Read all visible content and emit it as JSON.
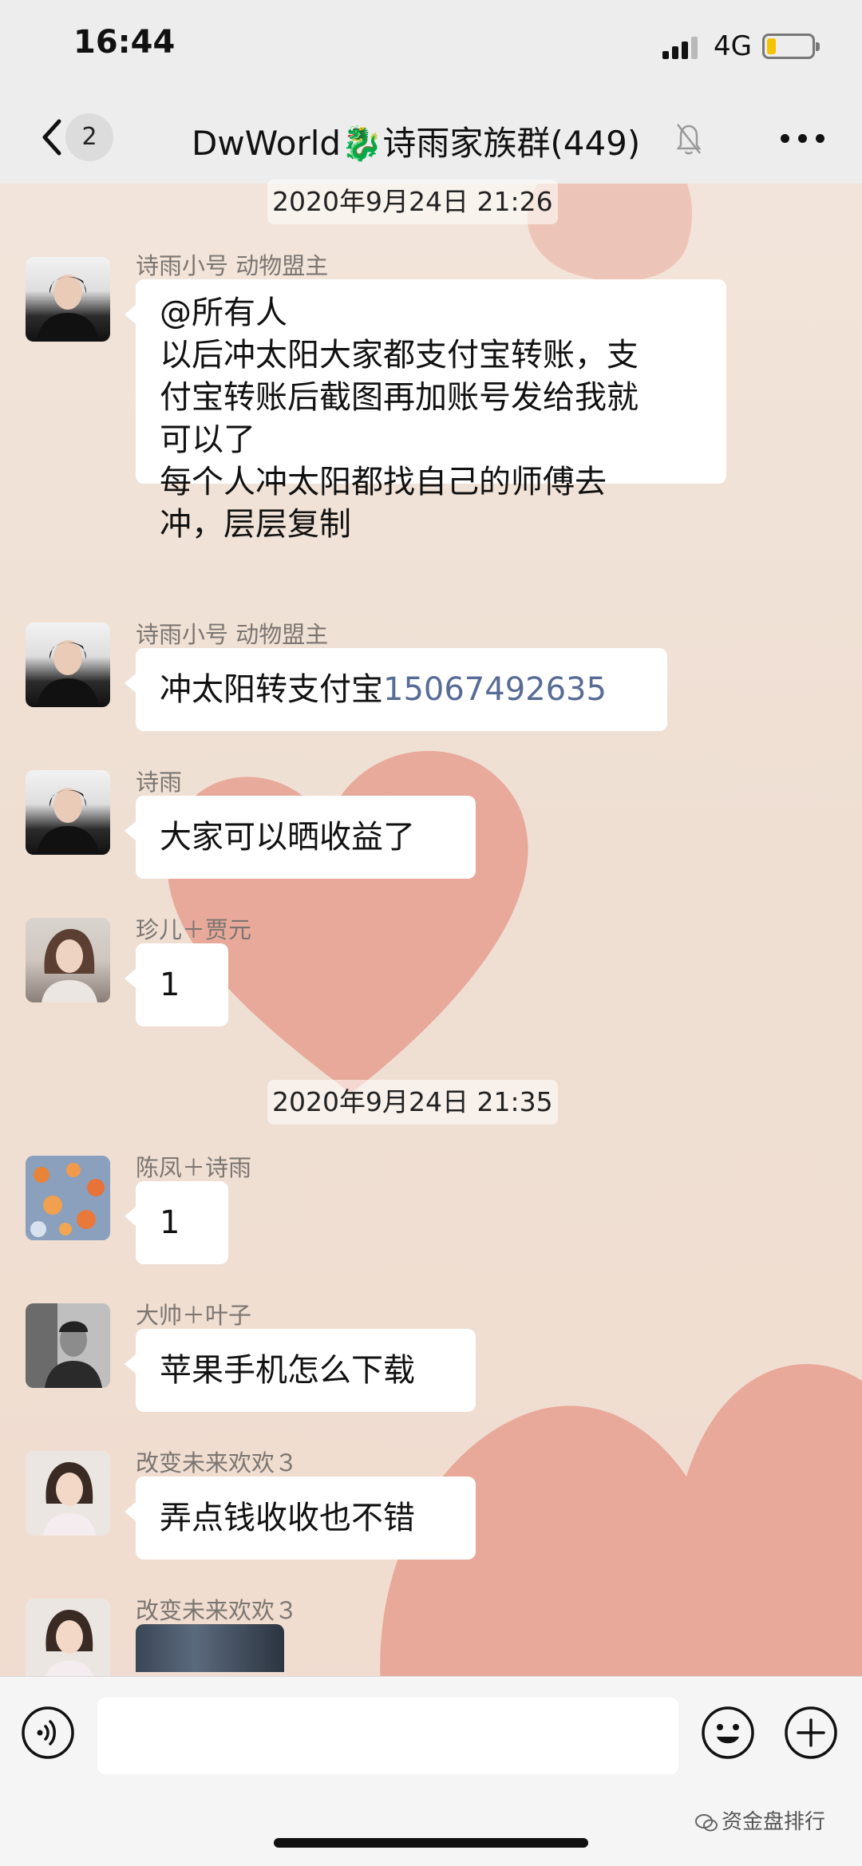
{
  "status_bar": {
    "time": "16:44",
    "network": "4G",
    "battery_level": 0.2
  },
  "header": {
    "back_count": "2",
    "title": "DwWorld🐉诗雨家族群(449)"
  },
  "messages": [
    {
      "type": "timestamp",
      "text": "2020年9月24日 21:26"
    },
    {
      "type": "text",
      "sender": "诗雨小号  动物盟主",
      "lines": [
        "@所有人",
        "以后冲太阳大家都支付宝转账，支",
        "付宝转账后截图再加账号发给我就",
        "可以了",
        "每个人冲太阳都找自己的师傅去",
        "冲，层层复制"
      ]
    },
    {
      "type": "text",
      "sender": "诗雨小号  动物盟主",
      "text_prefix": "冲太阳转支付宝",
      "phone": "15067492635"
    },
    {
      "type": "text",
      "sender": "诗雨",
      "text": "大家可以晒收益了"
    },
    {
      "type": "text",
      "sender": "珍儿＋贾元",
      "text": "1"
    },
    {
      "type": "timestamp",
      "text": "2020年9月24日 21:35"
    },
    {
      "type": "text",
      "sender": "陈凤＋诗雨",
      "text": "1"
    },
    {
      "type": "text",
      "sender": "大帅＋叶子",
      "text": "苹果手机怎么下载"
    },
    {
      "type": "text",
      "sender": "改变未来欢欢３",
      "text": "弄点钱收收也不错"
    },
    {
      "type": "image",
      "sender": "改变未来欢欢３"
    }
  ],
  "input_bar": {
    "voice_icon": "voice-icon",
    "emoji_icon": "emoji-icon",
    "plus_icon": "plus-icon"
  },
  "watermark": {
    "text": "资金盘排行"
  },
  "colors": {
    "bubble": "#ffffff",
    "link": "#576b95",
    "nav_bg": "#ededed",
    "heart": "#e8998a"
  }
}
